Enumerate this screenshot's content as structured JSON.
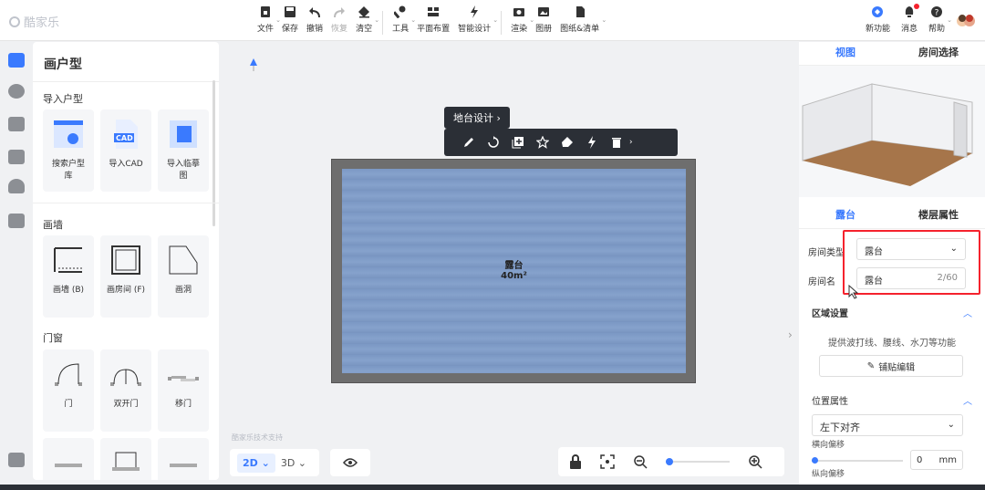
{
  "app": {
    "logo_text": "酷家乐"
  },
  "toolbar": {
    "items": [
      {
        "label": "文件",
        "icon": "file-icon",
        "caret": true
      },
      {
        "label": "保存",
        "icon": "save-icon",
        "caret": false
      },
      {
        "label": "撤销",
        "icon": "undo-icon",
        "caret": false
      },
      {
        "label": "恢复",
        "icon": "redo-icon",
        "caret": false,
        "disabled": true
      },
      {
        "label": "清空",
        "icon": "eraser-icon",
        "caret": true
      },
      {
        "label": "工具",
        "icon": "wrench-icon",
        "caret": true
      },
      {
        "label": "平面布置",
        "icon": "layout-icon",
        "caret": false
      },
      {
        "label": "智能设计",
        "icon": "lightning-icon",
        "caret": true
      },
      {
        "label": "渲染",
        "icon": "camera-icon",
        "caret": true
      },
      {
        "label": "图册",
        "icon": "album-icon",
        "caret": false
      },
      {
        "label": "图纸&清单",
        "icon": "document-icon",
        "caret": true
      }
    ],
    "right_items": [
      {
        "label": "新功能",
        "icon": "new-feature-icon"
      },
      {
        "label": "消息",
        "icon": "bell-icon"
      },
      {
        "label": "帮助",
        "icon": "help-icon"
      }
    ]
  },
  "left_panel": {
    "title": "画户型",
    "sections": [
      {
        "label": "导入户型",
        "cards": [
          {
            "label": "搜索户型库",
            "icon": "search-floorplan-icon"
          },
          {
            "label": "导入CAD",
            "icon": "cad-file-icon",
            "badge": "CAD"
          },
          {
            "label": "导入临摹图",
            "icon": "trace-image-icon"
          }
        ]
      },
      {
        "label": "画墙",
        "cards": [
          {
            "label": "画墙 (B)",
            "icon": "draw-wall-icon"
          },
          {
            "label": "画房间 (F)",
            "icon": "draw-room-icon"
          },
          {
            "label": "画洞",
            "icon": "draw-hole-icon"
          }
        ]
      },
      {
        "label": "门窗",
        "cards": [
          {
            "label": "门",
            "icon": "door-icon"
          },
          {
            "label": "双开门",
            "icon": "double-door-icon"
          },
          {
            "label": "移门",
            "icon": "sliding-door-icon"
          }
        ]
      }
    ]
  },
  "canvas": {
    "tooltip": "地台设计",
    "room_name": "露台",
    "room_area": "40m²",
    "watermark": "酷家乐技术支持",
    "view_2d": "2D",
    "view_3d": "3D"
  },
  "right_panel": {
    "tab_view": "视图",
    "tab_room_select": "房间选择",
    "tab_terrace": "露台",
    "tab_floor_attr": "楼层属性",
    "room_type_label": "房间类型",
    "room_type_value": "露台",
    "room_name_label": "房间名",
    "room_name_value": "露台",
    "room_name_count": "2/60",
    "zone_settings": "区域设置",
    "zone_desc": "提供波打线、腰线、水刀等功能",
    "edit_button": "铺贴编辑",
    "position_attr": "位置属性",
    "align_value": "左下对齐",
    "h_offset_label": "横向偏移",
    "h_offset_value": "0",
    "h_offset_unit": "mm",
    "v_offset_label": "纵向偏移"
  },
  "colors": {
    "accent": "#3a7afe",
    "highlight": "#f5222d",
    "floor": "#7b98c4",
    "dark_bar": "#2b2f36"
  }
}
